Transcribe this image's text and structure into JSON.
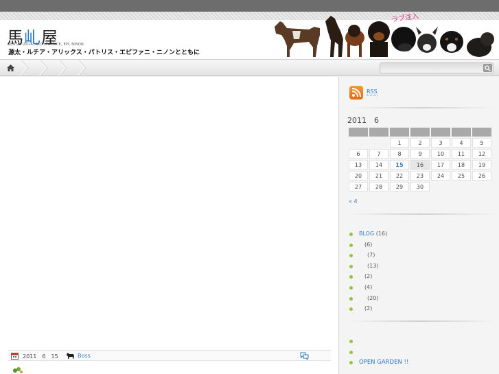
{
  "header": {
    "logo": {
      "left": "馬",
      "mid": "乢",
      "right": "屋"
    },
    "logo_sub": "GENTA, LUCIA, ALIX, PATRICE, EPI, NINON",
    "tagline": "源太・ルチア・アリックス・パトリス・エピファニ・ニノンとともに",
    "love_text": "ラブ注入"
  },
  "nav": {
    "search_placeholder": ""
  },
  "post": {
    "title": "",
    "date": "2011　6　15",
    "author": "Boss"
  },
  "sidebar": {
    "rss_label": "RSS",
    "calendar": {
      "caption": "2011　6",
      "weeks": [
        [
          "",
          "",
          "1",
          "2",
          "3",
          "4",
          "5"
        ],
        [
          "6",
          "7",
          "8",
          "9",
          "10",
          "11",
          "12"
        ],
        [
          "13",
          "14",
          "15",
          "16",
          "17",
          "18",
          "19"
        ],
        [
          "20",
          "21",
          "22",
          "23",
          "24",
          "25",
          "26"
        ],
        [
          "27",
          "28",
          "29",
          "30",
          "",
          "",
          ""
        ]
      ],
      "linked_day": "15",
      "today": "16",
      "prev_link": "« 4"
    },
    "categories": [
      {
        "name": "BLOG",
        "count": "(16)"
      },
      {
        "name": "",
        "count": "(6)"
      },
      {
        "name": "",
        "count": "(7)"
      },
      {
        "name": "",
        "count": "(13)"
      },
      {
        "name": "",
        "count": "(2)"
      },
      {
        "name": "",
        "count": "(4)"
      },
      {
        "name": "",
        "count": "(20)"
      },
      {
        "name": "",
        "count": "(2)"
      }
    ],
    "pages": [
      {
        "label": ""
      },
      {
        "label": ""
      },
      {
        "label": "OPEN GARDEN !!"
      }
    ]
  },
  "colors": {
    "accent": "#2a79c4",
    "bullet": "#8dc63f",
    "topbar": "#6d6d6d",
    "rss": "#e87a1f",
    "love": "#e0338a"
  }
}
